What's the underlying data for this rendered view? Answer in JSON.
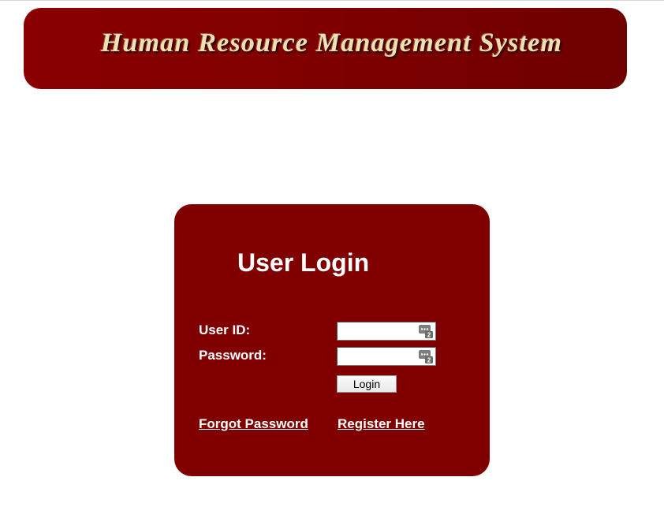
{
  "header": {
    "title": "Human Resource Management System"
  },
  "login": {
    "title": "User Login",
    "userid_label": "User ID:",
    "password_label": "Password:",
    "userid_value": "",
    "password_value": "",
    "login_button": "Login",
    "forgot_link": "Forgot Password",
    "register_link": "Register Here"
  },
  "icons": {
    "password_manager": "password-manager-icon",
    "badge_number": "2"
  },
  "colors": {
    "brand": "#800000",
    "banner_text": "#efe0b4",
    "text_on_brand": "#ffffff"
  }
}
